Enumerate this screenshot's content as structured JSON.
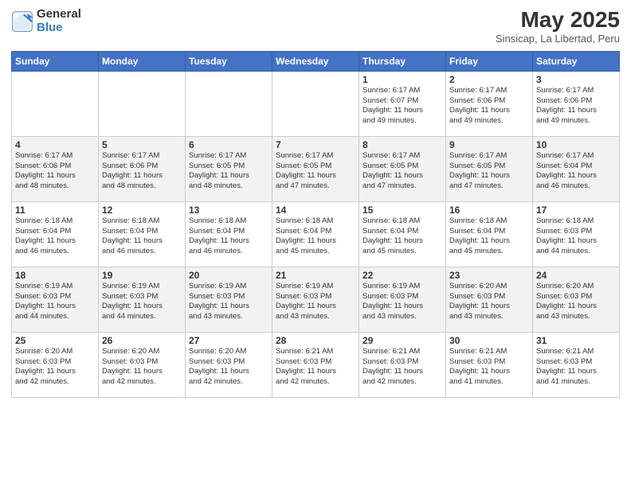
{
  "logo": {
    "general": "General",
    "blue": "Blue"
  },
  "header": {
    "month_year": "May 2025",
    "location": "Sinsicap, La Libertad, Peru"
  },
  "weekdays": [
    "Sunday",
    "Monday",
    "Tuesday",
    "Wednesday",
    "Thursday",
    "Friday",
    "Saturday"
  ],
  "weeks": [
    [
      {
        "day": "",
        "info": ""
      },
      {
        "day": "",
        "info": ""
      },
      {
        "day": "",
        "info": ""
      },
      {
        "day": "",
        "info": ""
      },
      {
        "day": "1",
        "info": "Sunrise: 6:17 AM\nSunset: 6:07 PM\nDaylight: 11 hours\nand 49 minutes."
      },
      {
        "day": "2",
        "info": "Sunrise: 6:17 AM\nSunset: 6:06 PM\nDaylight: 11 hours\nand 49 minutes."
      },
      {
        "day": "3",
        "info": "Sunrise: 6:17 AM\nSunset: 6:06 PM\nDaylight: 11 hours\nand 49 minutes."
      }
    ],
    [
      {
        "day": "4",
        "info": "Sunrise: 6:17 AM\nSunset: 6:06 PM\nDaylight: 11 hours\nand 48 minutes."
      },
      {
        "day": "5",
        "info": "Sunrise: 6:17 AM\nSunset: 6:06 PM\nDaylight: 11 hours\nand 48 minutes."
      },
      {
        "day": "6",
        "info": "Sunrise: 6:17 AM\nSunset: 6:05 PM\nDaylight: 11 hours\nand 48 minutes."
      },
      {
        "day": "7",
        "info": "Sunrise: 6:17 AM\nSunset: 6:05 PM\nDaylight: 11 hours\nand 47 minutes."
      },
      {
        "day": "8",
        "info": "Sunrise: 6:17 AM\nSunset: 6:05 PM\nDaylight: 11 hours\nand 47 minutes."
      },
      {
        "day": "9",
        "info": "Sunrise: 6:17 AM\nSunset: 6:05 PM\nDaylight: 11 hours\nand 47 minutes."
      },
      {
        "day": "10",
        "info": "Sunrise: 6:17 AM\nSunset: 6:04 PM\nDaylight: 11 hours\nand 46 minutes."
      }
    ],
    [
      {
        "day": "11",
        "info": "Sunrise: 6:18 AM\nSunset: 6:04 PM\nDaylight: 11 hours\nand 46 minutes."
      },
      {
        "day": "12",
        "info": "Sunrise: 6:18 AM\nSunset: 6:04 PM\nDaylight: 11 hours\nand 46 minutes."
      },
      {
        "day": "13",
        "info": "Sunrise: 6:18 AM\nSunset: 6:04 PM\nDaylight: 11 hours\nand 46 minutes."
      },
      {
        "day": "14",
        "info": "Sunrise: 6:18 AM\nSunset: 6:04 PM\nDaylight: 11 hours\nand 45 minutes."
      },
      {
        "day": "15",
        "info": "Sunrise: 6:18 AM\nSunset: 6:04 PM\nDaylight: 11 hours\nand 45 minutes."
      },
      {
        "day": "16",
        "info": "Sunrise: 6:18 AM\nSunset: 6:04 PM\nDaylight: 11 hours\nand 45 minutes."
      },
      {
        "day": "17",
        "info": "Sunrise: 6:18 AM\nSunset: 6:03 PM\nDaylight: 11 hours\nand 44 minutes."
      }
    ],
    [
      {
        "day": "18",
        "info": "Sunrise: 6:19 AM\nSunset: 6:03 PM\nDaylight: 11 hours\nand 44 minutes."
      },
      {
        "day": "19",
        "info": "Sunrise: 6:19 AM\nSunset: 6:03 PM\nDaylight: 11 hours\nand 44 minutes."
      },
      {
        "day": "20",
        "info": "Sunrise: 6:19 AM\nSunset: 6:03 PM\nDaylight: 11 hours\nand 43 minutes."
      },
      {
        "day": "21",
        "info": "Sunrise: 6:19 AM\nSunset: 6:03 PM\nDaylight: 11 hours\nand 43 minutes."
      },
      {
        "day": "22",
        "info": "Sunrise: 6:19 AM\nSunset: 6:03 PM\nDaylight: 11 hours\nand 43 minutes."
      },
      {
        "day": "23",
        "info": "Sunrise: 6:20 AM\nSunset: 6:03 PM\nDaylight: 11 hours\nand 43 minutes."
      },
      {
        "day": "24",
        "info": "Sunrise: 6:20 AM\nSunset: 6:03 PM\nDaylight: 11 hours\nand 43 minutes."
      }
    ],
    [
      {
        "day": "25",
        "info": "Sunrise: 6:20 AM\nSunset: 6:03 PM\nDaylight: 11 hours\nand 42 minutes."
      },
      {
        "day": "26",
        "info": "Sunrise: 6:20 AM\nSunset: 6:03 PM\nDaylight: 11 hours\nand 42 minutes."
      },
      {
        "day": "27",
        "info": "Sunrise: 6:20 AM\nSunset: 6:03 PM\nDaylight: 11 hours\nand 42 minutes."
      },
      {
        "day": "28",
        "info": "Sunrise: 6:21 AM\nSunset: 6:03 PM\nDaylight: 11 hours\nand 42 minutes."
      },
      {
        "day": "29",
        "info": "Sunrise: 6:21 AM\nSunset: 6:03 PM\nDaylight: 11 hours\nand 42 minutes."
      },
      {
        "day": "30",
        "info": "Sunrise: 6:21 AM\nSunset: 6:03 PM\nDaylight: 11 hours\nand 41 minutes."
      },
      {
        "day": "31",
        "info": "Sunrise: 6:21 AM\nSunset: 6:03 PM\nDaylight: 11 hours\nand 41 minutes."
      }
    ]
  ]
}
